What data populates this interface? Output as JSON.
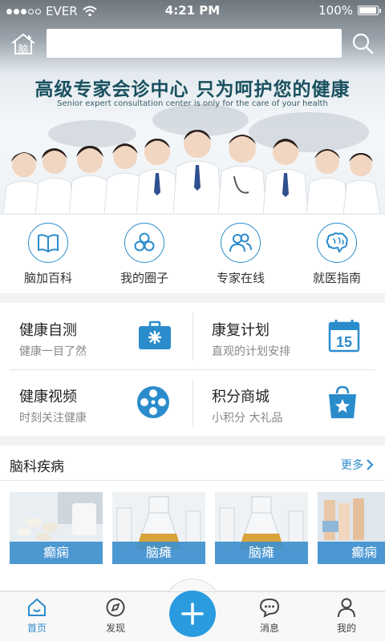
{
  "status_bar": {
    "carrier": "EVER",
    "time": "4:21 PM",
    "battery": "100%",
    "battery_level": 1.0,
    "signal_bars": 3,
    "signal_total": 5
  },
  "header": {
    "logo_text": "脑",
    "search_placeholder": "",
    "search_icon": "search-icon"
  },
  "banner": {
    "title": "高级专家会诊中心  只为呵护您的健康",
    "subtitle": "Senior expert consultation center is only for the care of your health"
  },
  "quick_nav": [
    {
      "label": "脑加百科",
      "icon": "book-icon"
    },
    {
      "label": "我的圈子",
      "icon": "circle-swirl-icon"
    },
    {
      "label": "专家在线",
      "icon": "people-icon"
    },
    {
      "label": "就医指南",
      "icon": "brain-icon"
    }
  ],
  "features": [
    {
      "title": "健康自测",
      "subtitle": "健康一目了然",
      "icon": "medical-kit-icon"
    },
    {
      "title": "康复计划",
      "subtitle": "直观的计划安排",
      "icon": "calendar-icon",
      "icon_text": "15"
    },
    {
      "title": "健康视频",
      "subtitle": "时刻关注健康",
      "icon": "film-reel-icon"
    },
    {
      "title": "积分商城",
      "subtitle": "小积分 大礼品",
      "icon": "shopping-bag-icon"
    }
  ],
  "disease_section": {
    "title": "脑科疾病",
    "more_label": "更多",
    "cards": [
      {
        "label": "癫痫"
      },
      {
        "label": "脑瘫"
      },
      {
        "label": "脑瘫"
      },
      {
        "label": "癫痫"
      }
    ]
  },
  "tabbar": {
    "tabs": [
      {
        "label": "首页",
        "icon": "home-icon",
        "active": true
      },
      {
        "label": "发现",
        "icon": "compass-icon",
        "active": false
      },
      {
        "label": "消息",
        "icon": "chat-bubble-icon",
        "active": false
      },
      {
        "label": "我的",
        "icon": "person-icon",
        "active": false
      }
    ],
    "fab_icon": "plus-icon"
  },
  "colors": {
    "accent": "#2b8ccc",
    "fab": "#2b9be0",
    "banner_title": "#19505f"
  }
}
